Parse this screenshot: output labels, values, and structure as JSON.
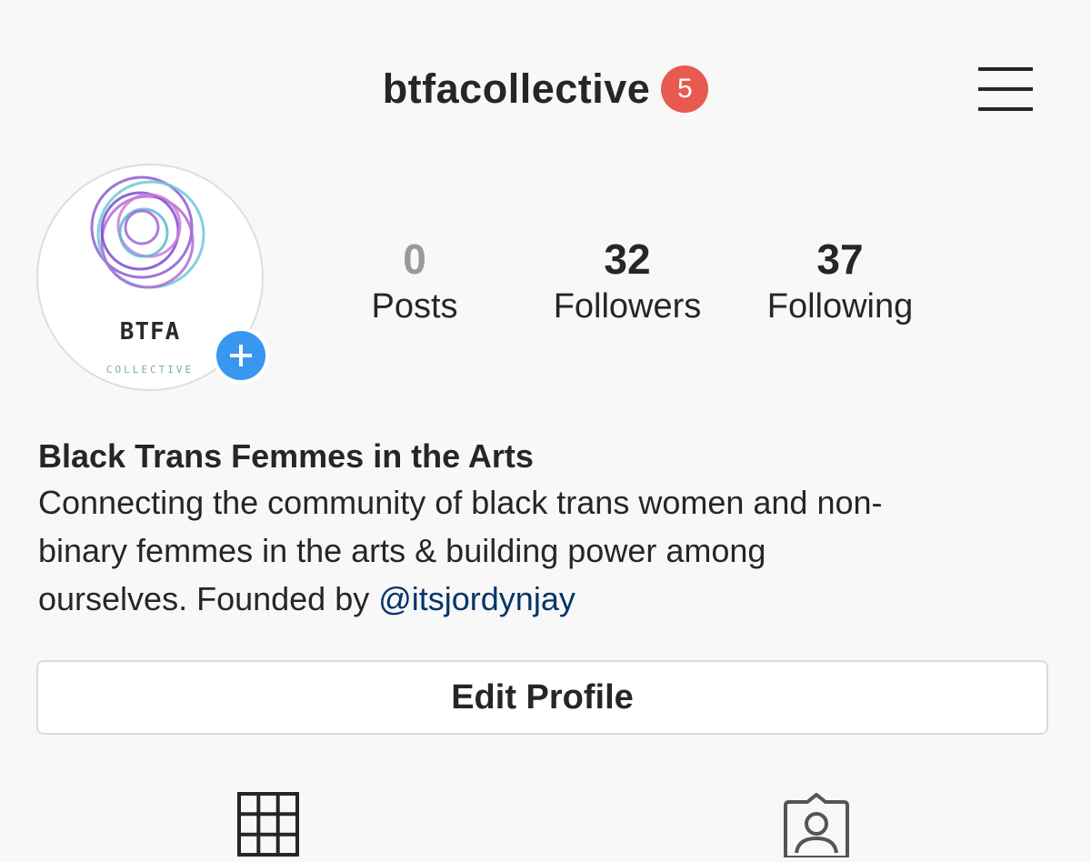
{
  "colors": {
    "badge": "#e85a4f",
    "accent": "#3897f0",
    "link": "#003569"
  },
  "header": {
    "username": "btfacollective",
    "notification_count": "5",
    "menu_icon": "hamburger-menu-icon"
  },
  "avatar": {
    "logo_title": "BTFA",
    "logo_subtitle": "COLLECTIVE",
    "add_icon": "plus-icon"
  },
  "stats": [
    {
      "value": "0",
      "label": "Posts"
    },
    {
      "value": "32",
      "label": "Followers"
    },
    {
      "value": "37",
      "label": "Following"
    }
  ],
  "bio": {
    "name": "Black Trans Femmes in the Arts",
    "line1": "Connecting the community of black trans women and non-",
    "line2": "binary femmes in the arts & building power among",
    "line3_text": "ourselves. Founded by ",
    "mention": "@itsjordynjay"
  },
  "actions": {
    "edit_profile": "Edit Profile"
  },
  "tabs": [
    {
      "icon": "grid-icon"
    },
    {
      "icon": "tagged-user-icon"
    }
  ]
}
